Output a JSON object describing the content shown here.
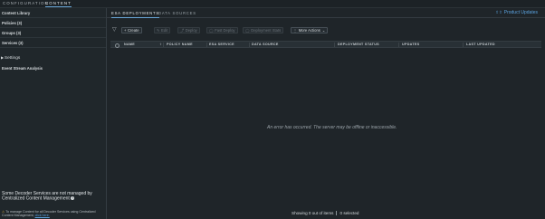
{
  "topnav": {
    "configuration": "CONFIGURATION",
    "content": "CONTENT"
  },
  "sidebar": {
    "items": [
      {
        "label": "Content Library"
      },
      {
        "label": "Policies (3)"
      },
      {
        "label": "Groups (3)"
      },
      {
        "label": "Services (3)"
      }
    ],
    "settings_label": "Settings",
    "esa_label": "Event Stream Analysis",
    "warning_text": "Some Decoder Services are not managed by Centralized Content Management",
    "note_text": "To manage Content for all Decoder Services using Centralized Content Management,",
    "note_link": "click here."
  },
  "tabs": [
    {
      "label": "ESA DEPLOYMENTS",
      "active": true
    },
    {
      "label": "DATA SOURCES",
      "active": false
    }
  ],
  "product_updates": "Product Updates",
  "toolbar": {
    "create": "Create",
    "edit": "Edit",
    "deploy": "Deploy",
    "fast_deploy": "Fast Deploy",
    "deployment_stats": "Deployment Stats",
    "more_actions": "More Actions"
  },
  "table": {
    "columns": [
      "NAME",
      "POLICY NAME",
      "ESA SERVICE",
      "DATA SOURCE",
      "DEPLOYMENT STATUS",
      "UPDATES",
      "LAST UPDATED"
    ]
  },
  "error_message": "An error has occurred. The server may be offline or inaccessible.",
  "footer": {
    "showing": "Showing 0 out of items",
    "selected": "0 selected"
  },
  "colors": {
    "accent": "#5ba3e0",
    "warning": "#e8b83d",
    "background": "#1f2529"
  }
}
